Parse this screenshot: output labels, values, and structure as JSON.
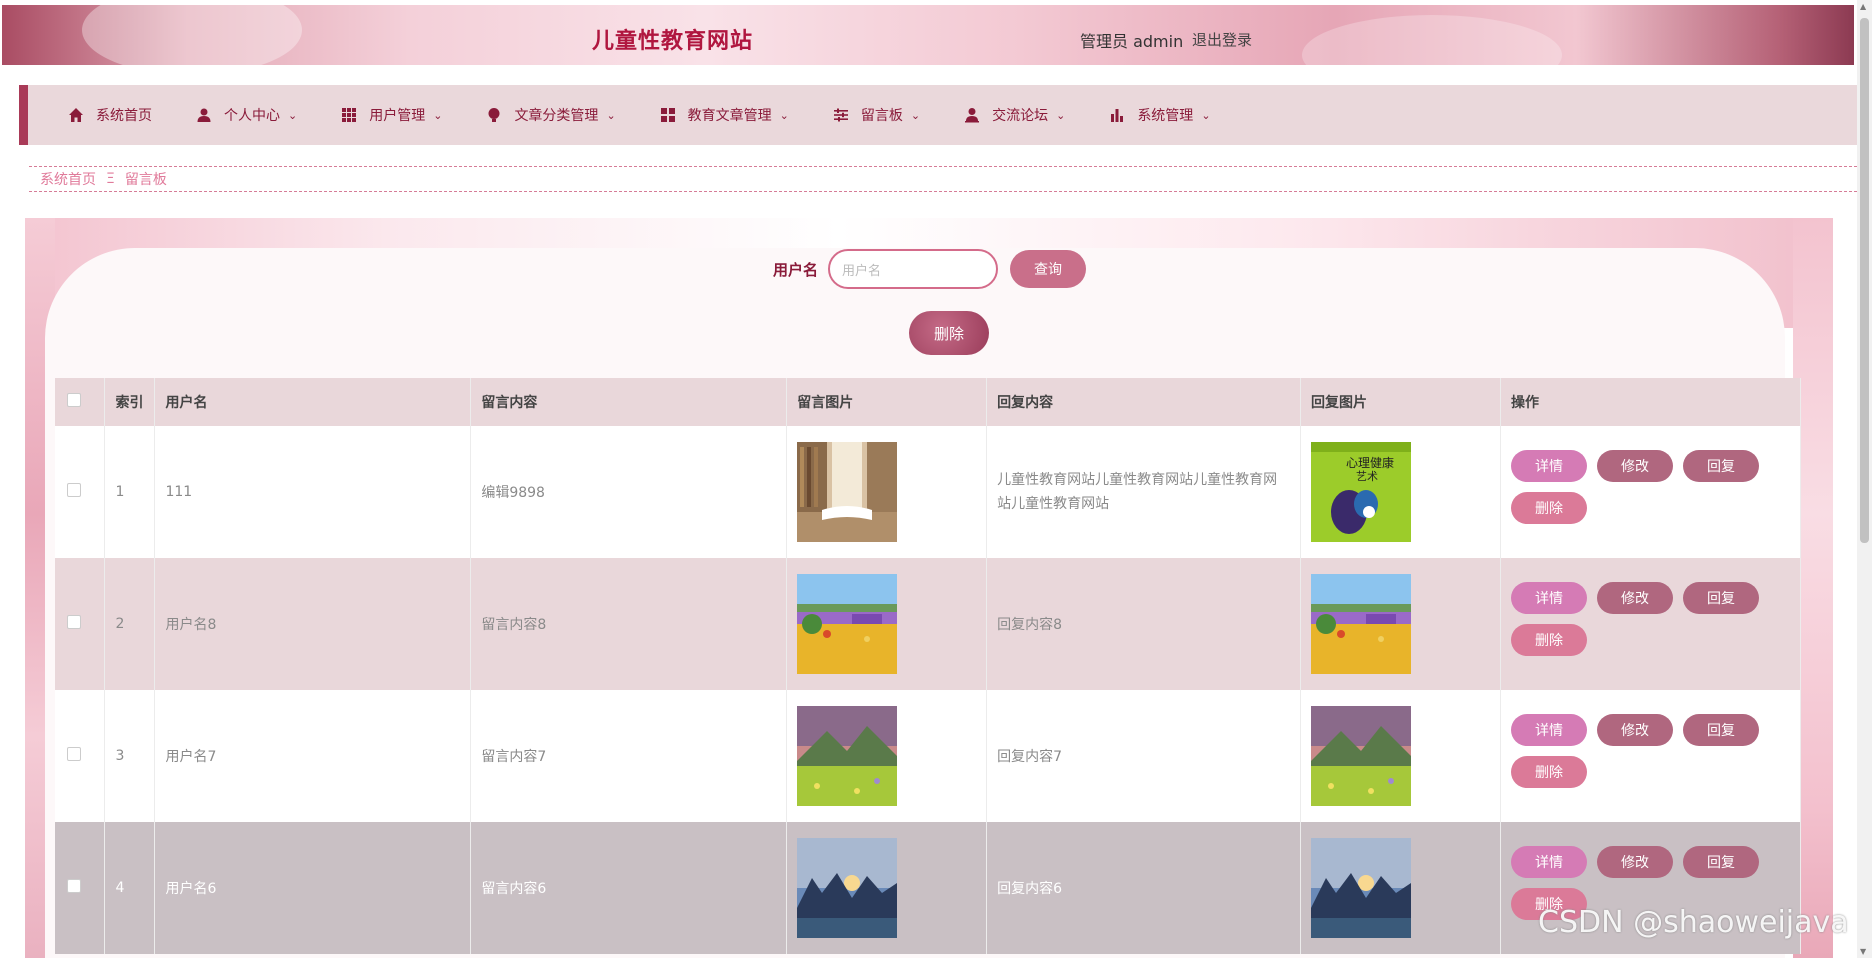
{
  "header": {
    "title": "儿童性教育网站",
    "user_label": "管理员 admin",
    "logout": "退出登录"
  },
  "nav": [
    {
      "label": "系统首页",
      "icon": "home-icon",
      "has_chevron": false
    },
    {
      "label": "个人中心",
      "icon": "user-icon",
      "has_chevron": true
    },
    {
      "label": "用户管理",
      "icon": "grid-icon",
      "has_chevron": true
    },
    {
      "label": "文章分类管理",
      "icon": "bulb-icon",
      "has_chevron": true
    },
    {
      "label": "教育文章管理",
      "icon": "apps-icon",
      "has_chevron": true
    },
    {
      "label": "留言板",
      "icon": "sliders-icon",
      "has_chevron": true
    },
    {
      "label": "交流论坛",
      "icon": "person-icon",
      "has_chevron": true
    },
    {
      "label": "系统管理",
      "icon": "bar-chart-icon",
      "has_chevron": true
    }
  ],
  "breadcrumb": {
    "home": "系统首页",
    "separator": "Ξ",
    "current": "留言板"
  },
  "search": {
    "label": "用户名",
    "placeholder": "用户名",
    "button": "查询"
  },
  "bulk_delete": "删除",
  "table": {
    "headers": [
      "索引",
      "用户名",
      "留言内容",
      "留言图片",
      "回复内容",
      "回复图片",
      "操作"
    ],
    "rows": [
      {
        "index": "1",
        "username": "111",
        "content": "编辑9898",
        "reply": "儿童性教育网站儿童性教育网站儿童性教育网站儿童性教育网站"
      },
      {
        "index": "2",
        "username": "用户名8",
        "content": "留言内容8",
        "reply": "回复内容8"
      },
      {
        "index": "3",
        "username": "用户名7",
        "content": "留言内容7",
        "reply": "回复内容7"
      },
      {
        "index": "4",
        "username": "用户名6",
        "content": "留言内容6",
        "reply": "回复内容6"
      }
    ],
    "actions": {
      "detail": "详情",
      "edit": "修改",
      "reply": "回复",
      "delete": "删除"
    }
  },
  "watermark": "CSDN @shaoweijava",
  "colors": {
    "brand": "#b0163f",
    "nav_bg": "#ead8db",
    "accent": "#c96f8a"
  }
}
